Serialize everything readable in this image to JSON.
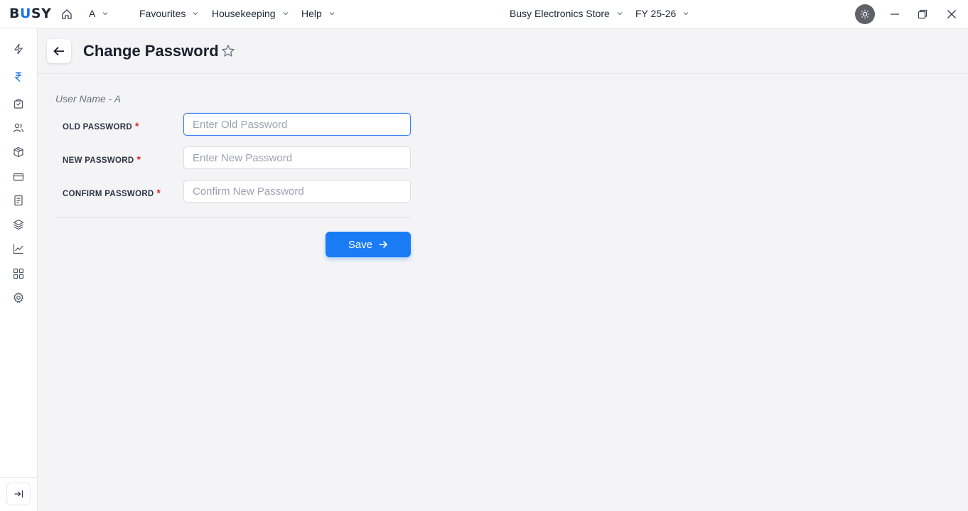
{
  "topbar": {
    "logo_pre": "B",
    "logo_u": "U",
    "logo_post": "SY",
    "user": "A",
    "menus": [
      "Favourites",
      "Housekeeping",
      "Help"
    ],
    "company": "Busy Electronics Store",
    "fiscal_year": "FY 25-26"
  },
  "sidebar": {
    "items": [
      "bolt-icon",
      "rupee-icon",
      "shopping-bag-icon",
      "users-icon",
      "box-icon",
      "card-icon",
      "document-icon",
      "layers-icon",
      "chart-line-icon",
      "grid-icon",
      "settings-icon"
    ],
    "active": "rupee-icon"
  },
  "page": {
    "title": "Change Password"
  },
  "form": {
    "user_name": "User Name - A",
    "old_label": "OLD PASSWORD",
    "old_placeholder": "Enter Old Password",
    "new_label": "NEW PASSWORD",
    "new_placeholder": "Enter New Password",
    "confirm_label": "CONFIRM PASSWORD",
    "confirm_placeholder": "Confirm New Password",
    "required_mark": "*",
    "save_label": "Save"
  },
  "colors": {
    "accent": "#1a7cf5",
    "required": "#dc2626",
    "background": "#f4f4f7"
  }
}
